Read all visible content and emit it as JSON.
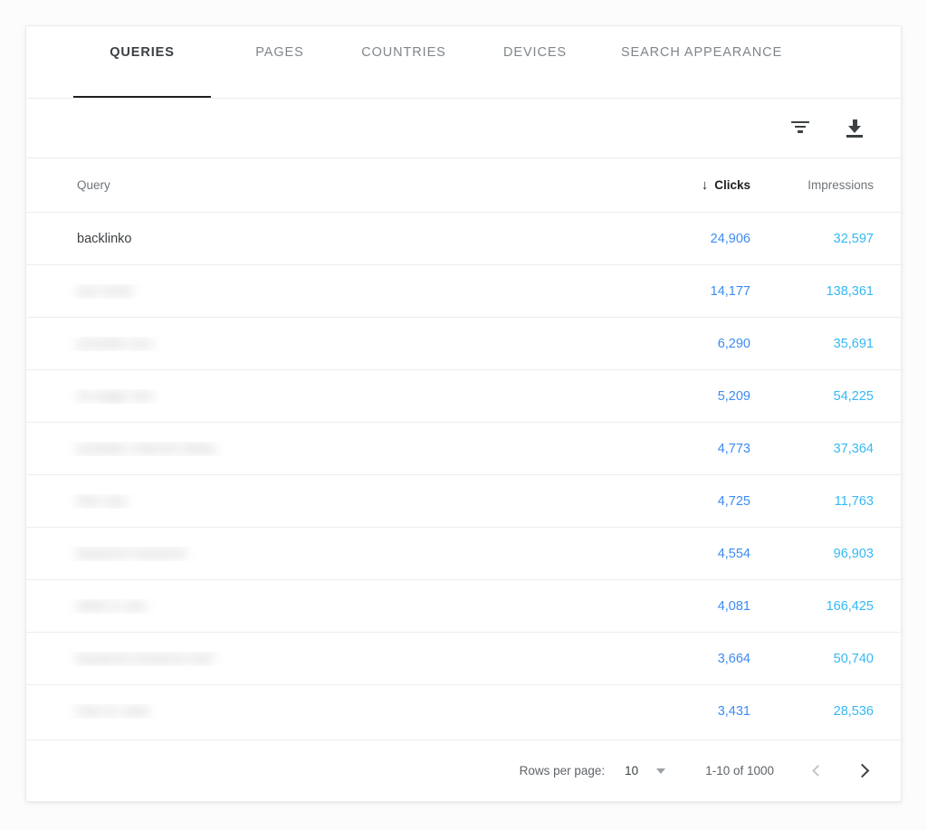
{
  "tabs": [
    {
      "label": "QUERIES",
      "active": true
    },
    {
      "label": "PAGES",
      "active": false
    },
    {
      "label": "COUNTRIES",
      "active": false
    },
    {
      "label": "DEVICES",
      "active": false
    },
    {
      "label": "SEARCH APPEARANCE",
      "active": false
    }
  ],
  "toolbar": {
    "filter_icon": "filter-icon",
    "download_icon": "download-icon"
  },
  "table": {
    "columns": {
      "query": "Query",
      "clicks": "Clicks",
      "impressions": "Impressions"
    },
    "sort": {
      "column": "Clicks",
      "direction": "desc",
      "arrow": "↓"
    },
    "rows": [
      {
        "query": "backlinko",
        "redacted": false,
        "clicks": "24,906",
        "impressions": "32,597"
      },
      {
        "query": "seo tools",
        "redacted": true,
        "clicks": "14,177",
        "impressions": "138,361"
      },
      {
        "query": "youtube seo",
        "redacted": true,
        "clicks": "6,290",
        "impressions": "35,691"
      },
      {
        "query": "on page seo",
        "redacted": true,
        "clicks": "5,209",
        "impressions": "54,225"
      },
      {
        "query": "youtube channel ideas",
        "redacted": true,
        "clicks": "4,773",
        "impressions": "37,364"
      },
      {
        "query": "free seo",
        "redacted": true,
        "clicks": "4,725",
        "impressions": "11,763"
      },
      {
        "query": "keyword research",
        "redacted": true,
        "clicks": "4,554",
        "impressions": "96,903"
      },
      {
        "query": "what is seo",
        "redacted": true,
        "clicks": "4,081",
        "impressions": "166,425"
      },
      {
        "query": "keyword research tool",
        "redacted": true,
        "clicks": "3,664",
        "impressions": "50,740"
      },
      {
        "query": "how to rank",
        "redacted": true,
        "clicks": "3,431",
        "impressions": "28,536"
      }
    ]
  },
  "footer": {
    "rows_per_page_label": "Rows per page:",
    "rows_per_page_value": "10",
    "range_label": "1-10 of 1000",
    "prev_icon": "chevron-left-icon",
    "next_icon": "chevron-right-icon"
  },
  "colors": {
    "clicks": "#3d8bf2",
    "impressions": "#34b9f3",
    "active_tab_underline": "#202124",
    "text_primary": "#3c4043",
    "text_secondary": "#70757a"
  }
}
